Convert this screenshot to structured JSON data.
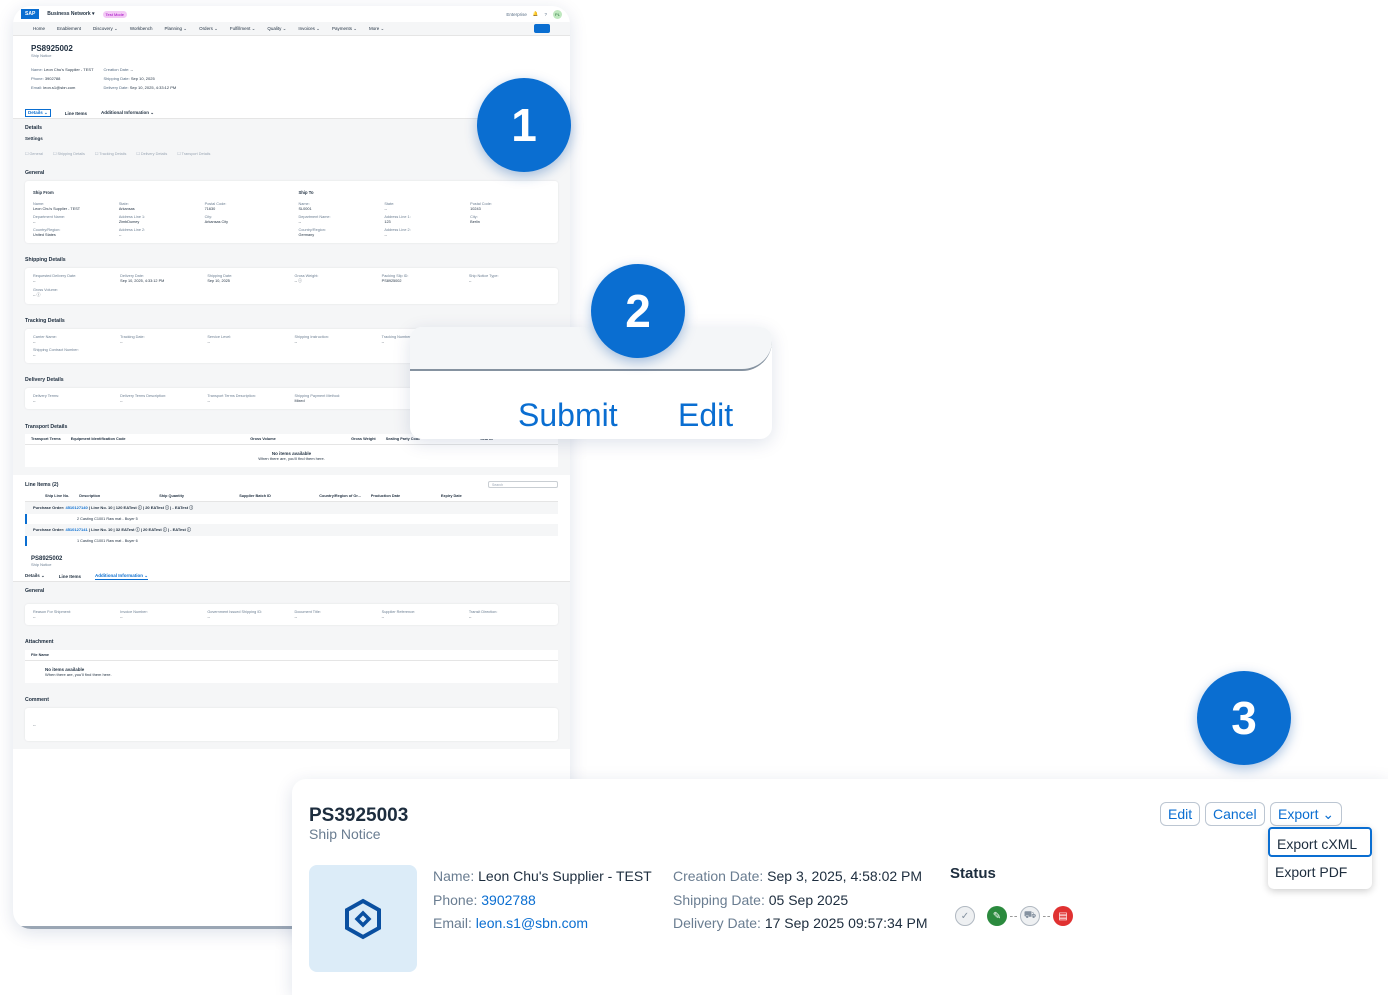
{
  "callouts": [
    "1",
    "2",
    "3"
  ],
  "shell": {
    "logo": "SAP",
    "product": "Business Network ▾",
    "test_mode": "Test Mode",
    "enterprise": "Enterprise",
    "avatar": "PL"
  },
  "nav": [
    "Home",
    "Enablement",
    "Discovery ⌄",
    "Workbench",
    "Planning ⌄",
    "Orders ⌄",
    "Fulfillment ⌄",
    "Quality ⌄",
    "Invoices ⌄",
    "Payments ⌄",
    "More ⌄"
  ],
  "doc": {
    "id": "PS8925002",
    "type": "Ship Notice",
    "name_label": "Name:",
    "name": "Leon Chu's Supplier - TEST",
    "phone_label": "Phone:",
    "phone": "3902788",
    "email_label": "Email:",
    "email": "leon.s1@sbn.com",
    "cdate_label": "Creation Date:",
    "cdate": "--",
    "sdate_label": "Shipping Date:",
    "sdate": "Sep 10, 2025",
    "ddate_label": "Delivery Date:",
    "ddate": "Sep 10, 2025, 4:33:12 PM"
  },
  "tabs": {
    "details": "Details ⌄",
    "line_items": "Line Items",
    "additional": "Additional Information ⌄"
  },
  "details": {
    "title": "Details",
    "settings": "Settings",
    "checkboxes": [
      "General",
      "Shipping Details",
      "Tracking Details",
      "Delivery Details",
      "Transport Details"
    ],
    "general": "General",
    "ship_from": "Ship From",
    "ship_to": "Ship To",
    "from_fields": [
      [
        "Name:",
        "Leon Chu's Supplier - TEST"
      ],
      [
        "State:",
        "Arkansas"
      ],
      [
        "Postal Code:",
        "71630"
      ],
      [
        "Department Name:",
        "--"
      ],
      [
        "Address Line 1:",
        "ZimbDumey"
      ],
      [
        "City:",
        "Arkansas City"
      ],
      [
        "Country/Region:",
        "United States"
      ],
      [
        "Address Line 2:",
        "--"
      ]
    ],
    "to_fields": [
      [
        "Name:",
        "SL0001"
      ],
      [
        "State:",
        "--"
      ],
      [
        "Postal Code:",
        "10243"
      ],
      [
        "Department Name:",
        "--"
      ],
      [
        "Address Line 1:",
        "123"
      ],
      [
        "City:",
        "Berlin"
      ],
      [
        "Country/Region:",
        "Germany"
      ],
      [
        "Address Line 2:",
        "--"
      ]
    ],
    "shipping": "Shipping Details",
    "shipping_fields": [
      [
        "Requested Delivery Date:",
        "--"
      ],
      [
        "Delivery Date:",
        "Sep 10, 2025, 4:33:12 PM"
      ],
      [
        "Shipping Date:",
        "Sep 10, 2025"
      ],
      [
        "Gross Weight:",
        "-- ⓘ"
      ],
      [
        "Packing Slip ID:",
        "PS8925002"
      ],
      [
        "Ship Notice Type:",
        "--"
      ],
      [
        "Gross Volume:",
        "-- ⓘ"
      ],
      [
        "",
        ""
      ]
    ],
    "tracking": "Tracking Details",
    "tracking_fields": [
      [
        "Carrier Name:",
        "--"
      ],
      [
        "Tracking Date:",
        "--"
      ],
      [
        "Service Level:",
        "--"
      ],
      [
        "Shipping Instruction:",
        "--"
      ],
      [
        "Tracking Number:",
        "--"
      ],
      [
        "Shipping Method:",
        "--"
      ],
      [
        "Shipping Contract Number:",
        "--"
      ],
      [
        "",
        ""
      ]
    ],
    "delivery": "Delivery Details",
    "delivery_fields": [
      [
        "Delivery Terms:",
        "--"
      ],
      [
        "Delivery Terms Description:",
        "--"
      ],
      [
        "Transport Terms Description:",
        "--"
      ],
      [
        "Shipping Payment Method:",
        "Mixed"
      ]
    ],
    "transport": "Transport Details",
    "search": "Search",
    "transport_cols": [
      "Transport Terms",
      "Equipment Identification Code",
      "Gross Volume",
      "Gross Weight",
      "Sealing Party Code",
      "Seal ID"
    ],
    "no_items": "No items available",
    "no_items_sub": "When there are, you'll find them here."
  },
  "line_items": {
    "title": "Line Items (2)",
    "cols": [
      "Ship Line No.",
      "Description",
      "Ship Quantity",
      "Supplier Batch ID",
      "Country/Region of Or...",
      "Production Date",
      "Expiry Date"
    ],
    "groups": [
      {
        "po_label": "Purchase Order:",
        "po": "4510127140",
        "rest": "| Line No. 10 | 120 EATest ⓘ | 20 EATest ⓘ | - EATest ⓘ",
        "row": "2    Casting C1001 Raw mat - Buyer    5"
      },
      {
        "po_label": "Purchase Order:",
        "po": "4510127141",
        "rest": "| Line No. 10 | 32 EATest ⓘ | 20 EATest ⓘ | - EATest ⓘ",
        "row": "1    Casting C1001 Raw mat - Buyer    6"
      }
    ]
  },
  "additional": {
    "general": "General",
    "fields": [
      [
        "Reason For Shipment:",
        "--"
      ],
      [
        "Invoice Number:",
        "--"
      ],
      [
        "Government Issued Shipping ID:",
        "--"
      ],
      [
        "Document Title:",
        "--"
      ],
      [
        "Supplier Reference:",
        "--"
      ],
      [
        "Transit Direction:",
        "--"
      ]
    ],
    "attachment": "Attachment",
    "file_name": "File Name",
    "comment": "Comment",
    "comment_val": "--"
  },
  "zoom2": {
    "submit": "Submit",
    "edit": "Edit"
  },
  "zoom3": {
    "id": "PS3925003",
    "type": "Ship Notice",
    "buttons": {
      "edit": "Edit",
      "cancel": "Cancel",
      "export": "Export ⌄"
    },
    "export_menu": [
      "Export cXML",
      "Export PDF"
    ],
    "name_label": "Name:",
    "name": "Leon Chu's Supplier - TEST",
    "phone_label": "Phone:",
    "phone": "3902788",
    "email_label": "Email:",
    "email": "leon.s1@sbn.com",
    "cdate_label": "Creation Date:",
    "cdate": "Sep 3, 2025, 4:58:02 PM",
    "sdate_label": "Shipping Date:",
    "sdate": "05 Sep 2025",
    "ddate_label": "Delivery Date:",
    "ddate": "17 Sep 2025 09:57:34 PM",
    "status": "Status",
    "status_icons": [
      "check-icon",
      "leaf-icon",
      "truck-icon",
      "invoice-icon"
    ]
  },
  "colors": {
    "accent": "#0a6ed1",
    "green": "#2b8a3e",
    "red": "#e03131"
  }
}
